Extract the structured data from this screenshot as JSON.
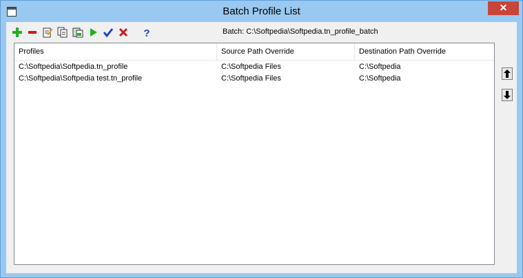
{
  "window": {
    "title": "Batch Profile List",
    "close_glyph": "✕"
  },
  "toolbar": {
    "buttons": [
      {
        "name": "add-profile-button",
        "icon": "plus-icon",
        "color": "#20b020"
      },
      {
        "name": "remove-profile-button",
        "icon": "minus-icon",
        "color": "#d01818"
      },
      {
        "name": "edit-profile-button",
        "icon": "edit-document-icon"
      },
      {
        "name": "copy-profile-button",
        "icon": "copy-document-icon"
      },
      {
        "name": "paste-profile-button",
        "icon": "paste-document-icon"
      },
      {
        "name": "run-button",
        "icon": "play-icon",
        "color": "#20b020"
      },
      {
        "name": "ok-button",
        "icon": "checkmark-icon",
        "color": "#1e3fd0"
      },
      {
        "name": "cancel-button",
        "icon": "x-icon",
        "color": "#d01818"
      },
      {
        "name": "help-button",
        "icon": "question-icon",
        "color": "#1e3fd0"
      }
    ],
    "batch_label": "Batch: C:\\Softpedia\\Softpedia.tn_profile_batch"
  },
  "list": {
    "columns": [
      "Profiles",
      "Source Path Override",
      "Destination Path Override"
    ],
    "rows": [
      [
        "C:\\Softpedia\\Softpedia.tn_profile",
        "C:\\Softpedia Files",
        "C:\\Softpedia"
      ],
      [
        "C:\\Softpedia\\Softpedia test.tn_profile",
        "C:\\Softpedia Files",
        "C:\\Softpedia"
      ]
    ]
  },
  "side_buttons": {
    "move_up_icon": "arrow-up-icon",
    "move_down_icon": "arrow-down-icon"
  }
}
